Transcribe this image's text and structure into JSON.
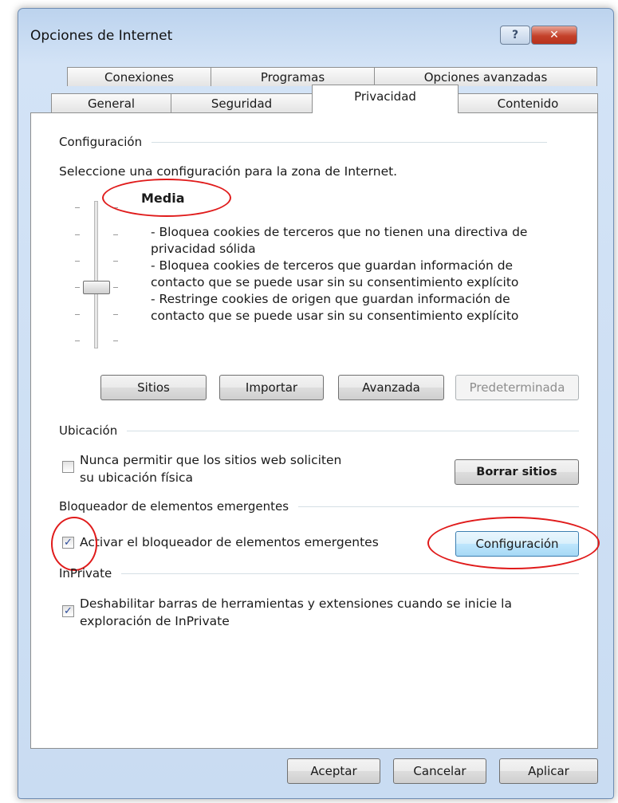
{
  "window": {
    "title": "Opciones de Internet",
    "help_label": "?",
    "close_label": "✕"
  },
  "tabs": {
    "row1": [
      "Conexiones",
      "Programas",
      "Opciones avanzadas"
    ],
    "row2": [
      "General",
      "Seguridad",
      "Privacidad",
      "Contenido"
    ],
    "active": "Privacidad"
  },
  "config": {
    "group_label": "Configuración",
    "instruction": "Seleccione una configuración para la zona de Internet.",
    "level": "Media",
    "description": [
      "- Bloquea cookies de terceros que no tienen una directiva de",
      "privacidad sólida",
      "- Bloquea cookies de terceros que guardan información de",
      "contacto que se puede usar sin su consentimiento explícito",
      "- Restringe cookies de origen que guardan información de",
      "contacto que se puede usar sin su consentimiento explícito"
    ],
    "buttons": {
      "sites": "Sitios",
      "import": "Importar",
      "advanced": "Avanzada",
      "default": "Predeterminada"
    }
  },
  "location": {
    "group_label": "Ubicación",
    "checkbox_label_1": "Nunca permitir que los sitios web soliciten",
    "checkbox_label_2": "su ubicación física",
    "checked": false,
    "clear_button": "Borrar sitios"
  },
  "popup": {
    "group_label": "Bloqueador de elementos emergentes",
    "checkbox_label": "Activar el bloqueador de elementos emergentes",
    "checked": true,
    "settings_button": "Configuración"
  },
  "inprivate": {
    "group_label": "InPrivate",
    "checkbox_label_1": "Deshabilitar barras de herramientas y extensiones cuando se inicie la",
    "checkbox_label_2": "exploración de InPrivate",
    "checked": true
  },
  "footer": {
    "ok": "Aceptar",
    "cancel": "Cancelar",
    "apply": "Aplicar"
  },
  "annotation_color": "#e01b1b"
}
